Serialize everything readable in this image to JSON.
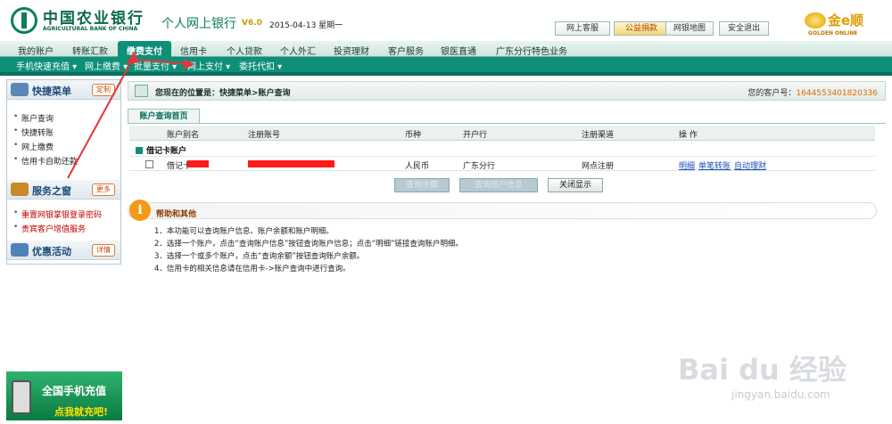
{
  "header": {
    "bank_name": "中国农业银行",
    "bank_name_en": "AGRICULTURAL BANK OF CHINA",
    "service": "个人网上银行",
    "version": "V6.0",
    "date": "2015-04-13 星期一",
    "buttons": [
      "网上客服",
      "公益捐款",
      "网银地图",
      "安全退出"
    ],
    "brand": "金e顺",
    "brand_en": "GOLDEN ONLINE"
  },
  "nav": {
    "main": [
      "我的账户",
      "转账汇款",
      "缴费支付",
      "信用卡",
      "个人贷款",
      "个人外汇",
      "投资理财",
      "客户服务",
      "银医直通",
      "广东分行特色业务"
    ],
    "active": "缴费支付",
    "sub": [
      "手机快速充值 ▾",
      "网上缴费 ▾",
      "批量支付 ▾",
      "网上支付 ▾",
      "委托代扣 ▾"
    ]
  },
  "sidebar": {
    "quick": {
      "title": "快捷菜单",
      "btn": "定制",
      "items": [
        "账户查询",
        "快捷转账",
        "网上缴费",
        "信用卡自助还款"
      ]
    },
    "service": {
      "title": "服务之窗",
      "btn": "更多",
      "items": [
        "重置网银掌银登录密码",
        "贵宾客户增值服务"
      ]
    },
    "promo": {
      "title": "优惠活动",
      "btn": "详情"
    },
    "ad": {
      "line1": "全国手机充值",
      "line2": "点我就充吧!"
    }
  },
  "main": {
    "breadcrumb": "您现在的位置是：快捷菜单>账户查询",
    "customer_label": "您的客户号：",
    "customer_no": "1644553401820336",
    "tab": "账户查询首页",
    "columns": [
      "账户别名",
      "注册账号",
      "币种",
      "开户行",
      "注册渠道",
      "操 作"
    ],
    "group": "借记卡账户",
    "row": {
      "alias": "借记卡",
      "currency": "人民币",
      "branch": "广东分行",
      "channel": "网点注册",
      "ops": [
        "明细",
        "单笔转账",
        "自动理财"
      ]
    },
    "buttons": [
      "查询余额",
      "查询账户信息",
      "关闭显示"
    ]
  },
  "help": {
    "title": "帮助和其他",
    "lines": [
      "1．本功能可以查询账户信息、账户余额和账户明细。",
      "2．选择一个账户，点击“查询账户信息”按钮查询账户信息；点击“明细”链接查询账户明细。",
      "3．选择一个或多个账户，点击“查询余额”按钮查询账户余额。",
      "4．信用卡的相关信息请在信用卡->账户查询中进行查询。"
    ]
  },
  "watermark": {
    "text": "Bai du 经验",
    "url": "jingyan.baidu.com"
  },
  "colors": {
    "brand_green": "#0e8f78",
    "annotation_red": "#e8343a"
  }
}
